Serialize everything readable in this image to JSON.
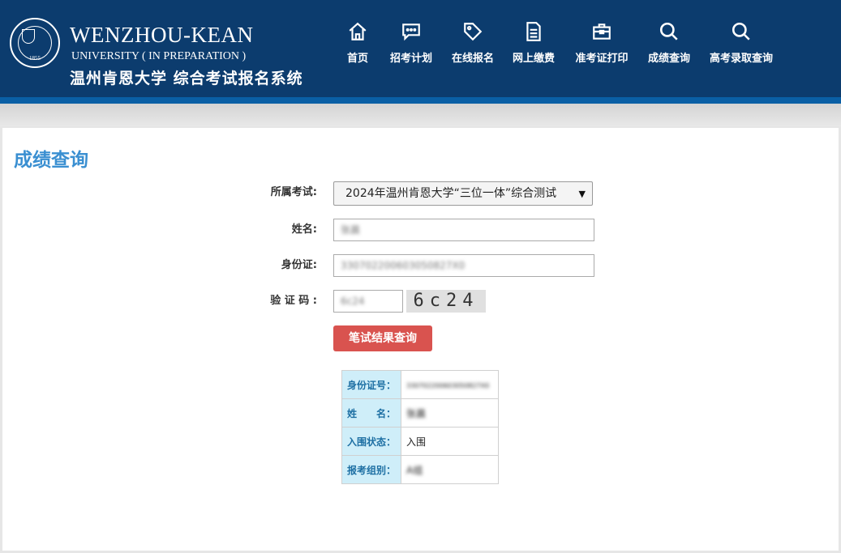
{
  "header": {
    "seal_year": "1855",
    "logo_en_line1": "WENZHOU-KEAN",
    "logo_en_line2": "UNIVERSITY ( IN PREPARATION )",
    "logo_cn": "温州肯恩大学 综合考试报名系统",
    "nav": [
      {
        "label": "首页",
        "icon": "home-icon"
      },
      {
        "label": "招考计划",
        "icon": "chat-icon"
      },
      {
        "label": "在线报名",
        "icon": "tag-icon"
      },
      {
        "label": "网上缴费",
        "icon": "document-icon"
      },
      {
        "label": "准考证打印",
        "icon": "briefcase-icon"
      },
      {
        "label": "成绩查询",
        "icon": "search-icon"
      },
      {
        "label": "高考录取查询",
        "icon": "search-icon"
      }
    ]
  },
  "main": {
    "title": "成绩查询",
    "form": {
      "exam_label": "所属考试:",
      "exam_value": "2024年温州肯恩大学“三位一体”综合测试",
      "name_label": "姓名:",
      "name_value": "张晨",
      "id_label": "身份证:",
      "id_value": "330702200603050827X0",
      "captcha_label": "验 证 码 :",
      "captcha_value": "6c24",
      "captcha_image_text": "6c24",
      "submit_label": "笔试结果查询"
    },
    "result": {
      "rows": [
        {
          "key": "身份证号：",
          "value": "330702200603050827X0"
        },
        {
          "key": "姓　　名：",
          "value": "张晨"
        },
        {
          "key": "入围状态：",
          "value": "入围"
        },
        {
          "key": "报考组别：",
          "value": "A组"
        }
      ]
    }
  },
  "colors": {
    "header_bg": "#0c3c6e",
    "title_blue": "#3a8fd1",
    "button_red": "#d9534f",
    "result_key_bg": "#cfeef9"
  }
}
